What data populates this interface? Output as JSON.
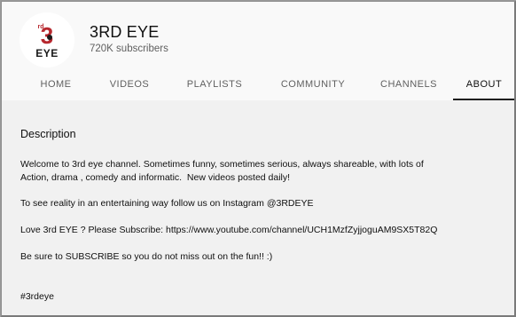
{
  "channel": {
    "name": "3RD EYE",
    "subscribers": "720K subscribers",
    "avatar_text_top": "3",
    "avatar_text_bottom": "EYE",
    "avatar_color": "#b7282e"
  },
  "tabs": [
    {
      "label": "HOME",
      "active": false
    },
    {
      "label": "VIDEOS",
      "active": false
    },
    {
      "label": "PLAYLISTS",
      "active": false
    },
    {
      "label": "COMMUNITY",
      "active": false
    },
    {
      "label": "CHANNELS",
      "active": false
    },
    {
      "label": "ABOUT",
      "active": true
    }
  ],
  "about": {
    "section_title": "Description",
    "paragraphs": [
      "Welcome to 3rd eye channel. Sometimes funny, sometimes serious, always shareable, with lots of\nAction, drama , comedy and informatic.  New videos posted daily!",
      "To see reality in an entertaining way follow us on Instagram @3RDEYE",
      "Love 3rd EYE ? Please Subscribe: https://www.youtube.com/channel/UCH1MzfZyjjoguAM9SX5T82Q",
      "Be sure to SUBSCRIBE so you do not miss out on the fun!! :)",
      "#3rdeye"
    ]
  }
}
